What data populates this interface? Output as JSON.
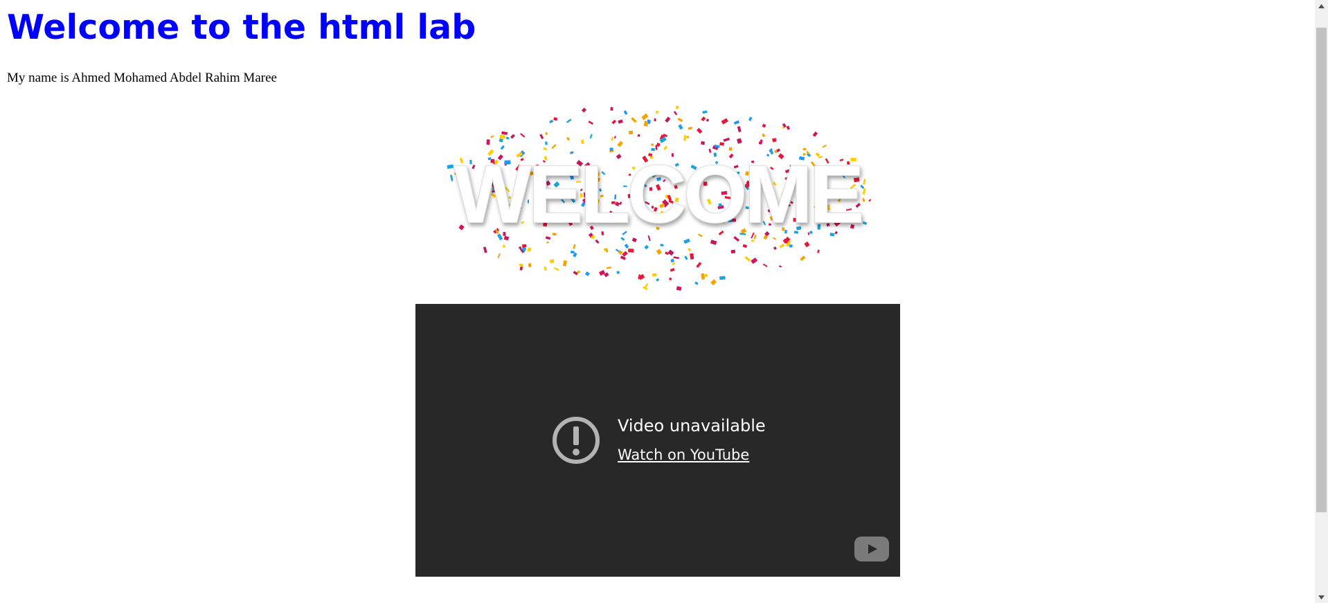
{
  "page": {
    "heading": "Welcome to the html lab",
    "intro": "My name is Ahmed Mohamed Abdel Rahim Maree"
  },
  "welcome_image": {
    "text": "WELCOME"
  },
  "video": {
    "title": "Video unavailable",
    "link_label": "Watch on YouTube",
    "icons": [
      "alert-circle-icon",
      "youtube-logo-icon"
    ]
  },
  "colors": {
    "heading": "#0000ff",
    "video_bg": "#282828",
    "scrollbar_track": "#f1f1f1",
    "scrollbar_thumb": "#c1c1c1"
  }
}
